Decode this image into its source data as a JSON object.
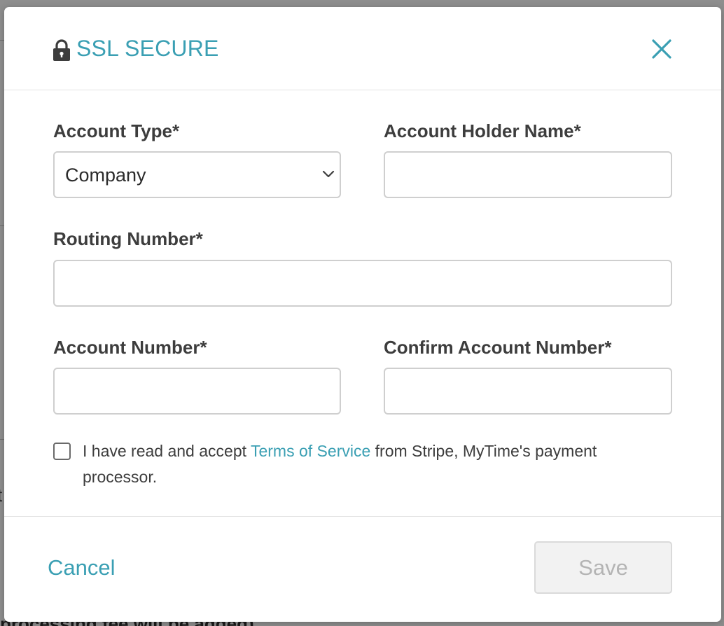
{
  "backdrop": {
    "partial_text": "processing fee will be added)",
    "partial_letter": "t"
  },
  "header": {
    "lock_icon": "lock-icon",
    "title": "SSL SECURE",
    "close_icon": "close-icon"
  },
  "form": {
    "account_type": {
      "label": "Account Type*",
      "value": "Company",
      "chevron_icon": "chevron-down-icon"
    },
    "account_holder_name": {
      "label": "Account Holder Name*",
      "value": ""
    },
    "routing_number": {
      "label": "Routing Number*",
      "value": ""
    },
    "account_number": {
      "label": "Account Number*",
      "value": ""
    },
    "confirm_account_number": {
      "label": "Confirm Account Number*",
      "value": ""
    },
    "terms": {
      "checked": false,
      "text_before": "I have read and accept ",
      "link_text": "Terms of Service",
      "text_after": " from Stripe, MyTime's payment processor."
    }
  },
  "footer": {
    "cancel_label": "Cancel",
    "save_label": "Save",
    "save_disabled": true
  },
  "colors": {
    "accent": "#3a9fb3",
    "label": "#3d3d3d",
    "border": "#cfcfcf",
    "disabled_bg": "#f2f2f2",
    "disabled_text": "#b4b4b4"
  }
}
